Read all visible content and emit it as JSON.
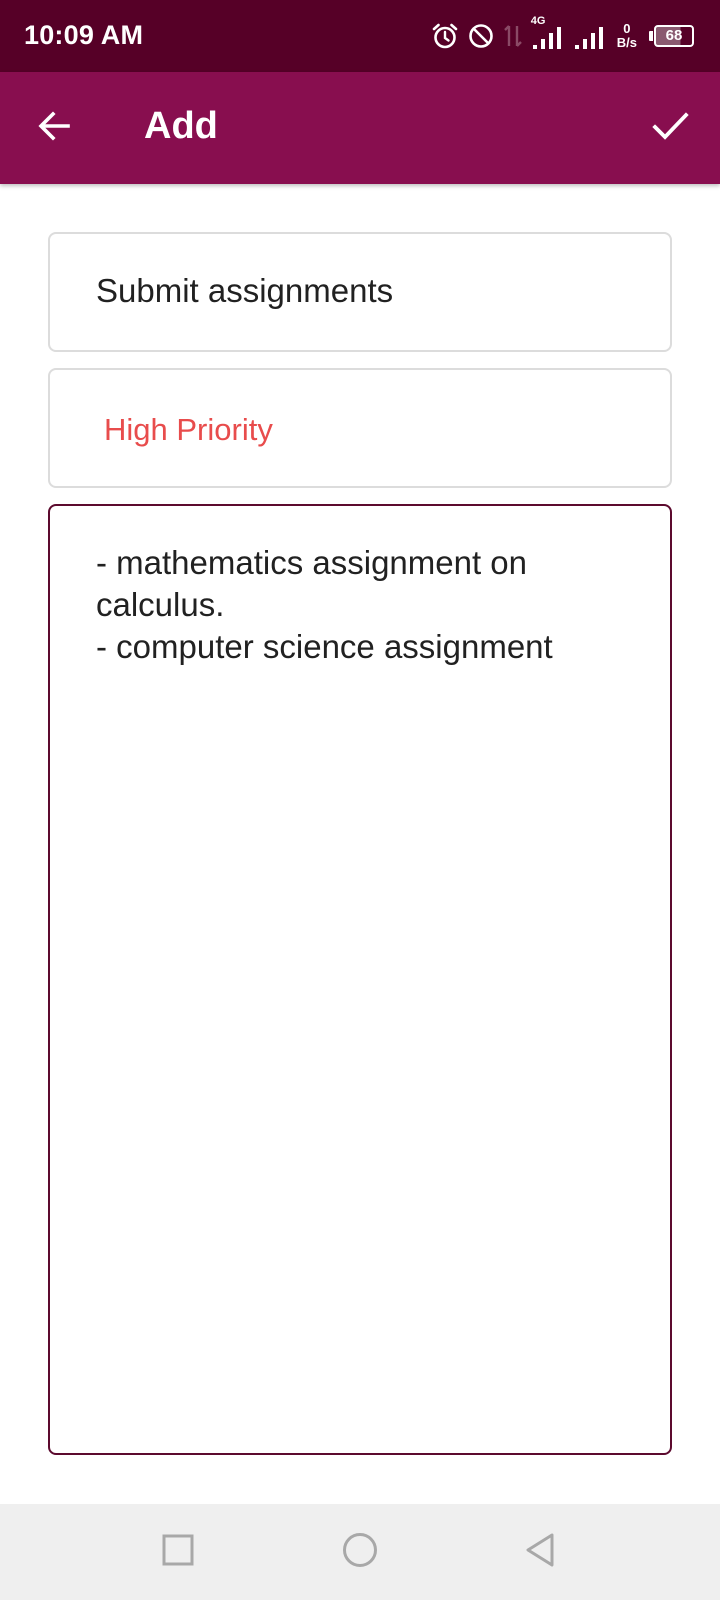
{
  "status_bar": {
    "time": "10:09 AM",
    "network_type": "4G",
    "speed_value": "0",
    "speed_unit": "B/s",
    "battery_level": "68",
    "icons": [
      "alarm-icon",
      "do-not-disturb-icon",
      "data-transfer-icon",
      "signal-icon",
      "signal-icon",
      "battery-icon"
    ]
  },
  "app_bar": {
    "title": "Add",
    "back_icon": "arrow-back-icon",
    "confirm_icon": "check-icon",
    "background": "#880e4f"
  },
  "form": {
    "title_value": "Submit assignments",
    "priority_value": "High Priority",
    "priority_color": "#e84c4c",
    "notes_value": "- mathematics assignment on\ncalculus.\n- computer science assignment"
  },
  "nav_bar": {
    "icons": [
      "recents-square-icon",
      "home-circle-icon",
      "back-triangle-icon"
    ]
  },
  "colors": {
    "status_bar": "#560027",
    "accent": "#880e4f",
    "notes_border": "#5c0a2e"
  }
}
